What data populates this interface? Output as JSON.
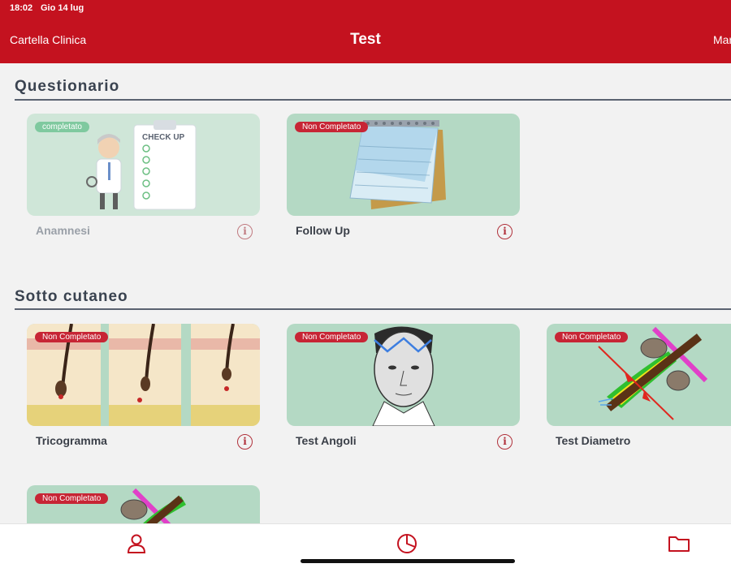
{
  "status_bar": {
    "time": "18:02",
    "date": "Gio 14 lug"
  },
  "nav": {
    "back_label": "Cartella Clinica",
    "title": "Test",
    "right_label": "Mar"
  },
  "sections": [
    {
      "title": "Questionario",
      "cards": [
        {
          "label": "Anamnesi",
          "status": "completato",
          "image_text": "CHECK UP",
          "icon": "info-icon"
        },
        {
          "label": "Follow Up",
          "status": "Non Completato",
          "icon": "info-icon"
        }
      ]
    },
    {
      "title": "Sotto cutaneo",
      "cards": [
        {
          "label": "Tricogramma",
          "status": "Non Completato",
          "icon": "info-icon"
        },
        {
          "label": "Test Angoli",
          "status": "Non Completato",
          "icon": "info-icon"
        },
        {
          "label": "Test Diametro",
          "status": "Non Completato"
        },
        {
          "status": "Non Completato"
        }
      ]
    }
  ],
  "tabbar": {
    "icons": [
      "person-icon",
      "pie-chart-icon",
      "folder-icon"
    ]
  },
  "colors": {
    "brand": "#c4121f",
    "card": "#b4d9c4",
    "badge_pending": "#c72535",
    "badge_done": "#7fc99f"
  }
}
